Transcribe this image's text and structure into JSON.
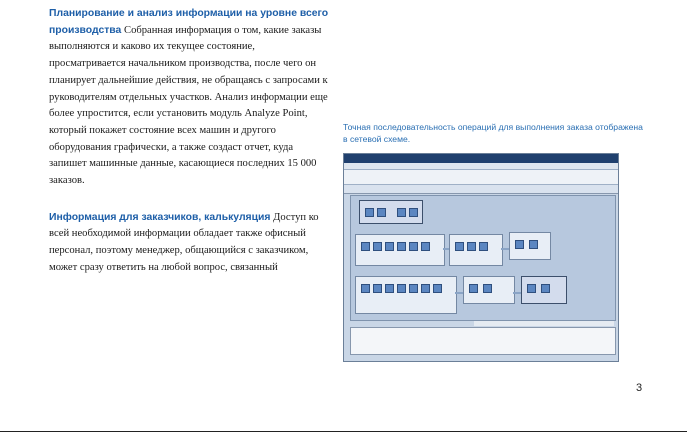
{
  "sections": [
    {
      "heading": "Планирование и анализ информации на уровне всего производства",
      "text": "Собранная информация о том, какие заказы выполняются и каково их текущее состояние, просматривается начальником производства, после чего он планирует дальнейшие действия, не обращаясь с запросами к руководителям отдельных участков. Анализ информации еще более упростится, если установить модуль Analyze Point, который покажет состояние всех машин и другого оборудования графически, а также создаст отчет, куда запишет машинные данные, касающиеся последних 15 000 заказов."
    },
    {
      "heading": "Информация для заказчиков, калькуляция",
      "text": "Доступ ко всей необходимой информации обладает также офисный персонал, поэтому менеджер, общающийся с заказчиком, может сразу ответить на любой вопрос, связанный"
    }
  ],
  "caption": "Точная последовательность операций для выполнения заказа отображена в сетевой схеме.",
  "page_number": "3"
}
